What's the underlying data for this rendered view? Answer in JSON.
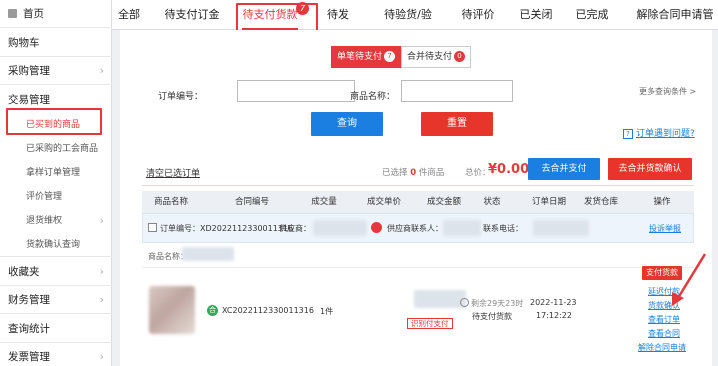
{
  "sidebar": {
    "items": [
      {
        "label": "首页",
        "chevron": false,
        "type": "main"
      },
      {
        "label": "购物车",
        "chevron": false,
        "type": "main"
      },
      {
        "label": "采购管理",
        "chevron": true,
        "type": "main"
      },
      {
        "label": "交易管理",
        "chevron": false,
        "type": "main"
      },
      {
        "label": "已买到的商品",
        "chevron": false,
        "type": "sub",
        "active": true
      },
      {
        "label": "已采购的工会商品",
        "chevron": false,
        "type": "sub"
      },
      {
        "label": "拿样订单管理",
        "chevron": false,
        "type": "sub"
      },
      {
        "label": "评价管理",
        "chevron": false,
        "type": "sub"
      },
      {
        "label": "退货维权",
        "chevron": true,
        "type": "sub"
      },
      {
        "label": "货款确认查询",
        "chevron": false,
        "type": "sub"
      },
      {
        "label": "收藏夹",
        "chevron": true,
        "type": "main"
      },
      {
        "label": "财务管理",
        "chevron": true,
        "type": "main"
      },
      {
        "label": "查询统计",
        "chevron": false,
        "type": "main"
      },
      {
        "label": "发票管理",
        "chevron": true,
        "type": "main"
      }
    ]
  },
  "tabs": [
    {
      "label": "全部"
    },
    {
      "label": "待支付订金"
    },
    {
      "label": "待支付货款",
      "active": true,
      "badge": "7"
    },
    {
      "label": "待发货"
    },
    {
      "label": "待验货/验票"
    },
    {
      "label": "待评价"
    },
    {
      "label": "已关闭"
    },
    {
      "label": "已完成"
    },
    {
      "label": "解除合同申请管理"
    }
  ],
  "segments": {
    "single": {
      "label": "单笔待支付",
      "badge": "7"
    },
    "merge": {
      "label": "合并待支付",
      "badge": "0"
    }
  },
  "filters": {
    "order_no_label": "订单编号：",
    "order_no_value": "",
    "product_name_label": "商品名称：",
    "product_name_value": "",
    "more_conditions": "更多查询条件 >",
    "query_button": "查询",
    "reset_button": "重置",
    "help_link": "订单遇到问题?",
    "help_icon": "?"
  },
  "summary": {
    "clear_selected": "清空已选订单",
    "selected_prefix": "已选择",
    "selected_count": "0",
    "selected_suffix": "件商品",
    "total_label": "总价：",
    "total_value": "¥0.00",
    "merge_pay_button": "去合并支付",
    "merge_confirm_button": "去合并货款确认"
  },
  "table": {
    "headers": [
      "商品名称",
      "合同编号",
      "成交量",
      "成交单价",
      "成交金额",
      "状态",
      "订单日期",
      "发货仓库",
      "操作"
    ],
    "order": {
      "order_no_label": "订单编号：",
      "order_no": "XD2022112330011316",
      "supplier_label": "供应商：",
      "supplier_contact_label": "供应商联系人：",
      "phone_label": "联系电话：",
      "action": "投诉举报"
    },
    "product_name_label": "商品名称：",
    "row": {
      "contract_icon": "合",
      "contract_no": "XC2022112330011316",
      "quantity": "1件",
      "pay_tag": "识别付支付",
      "remaining": "剩余29天23时",
      "status": "待支付货款",
      "date": "2022-11-23",
      "time": "17:12:22",
      "pay_button": "支付货款",
      "actions": [
        "延迟付款",
        "货款确认",
        "查看订单",
        "查看合同",
        "解除合同申请"
      ]
    }
  },
  "colors": {
    "accent_red": "#e4393c",
    "blue": "#1a7fe0"
  }
}
